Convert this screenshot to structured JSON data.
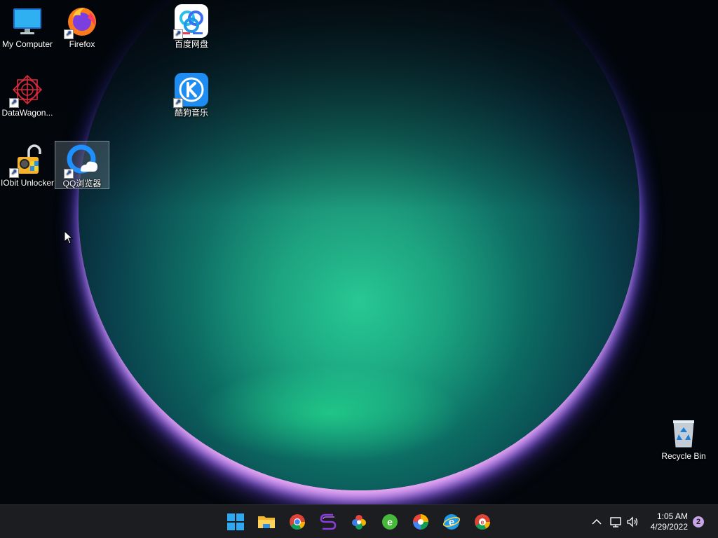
{
  "desktop": {
    "icons": {
      "my_computer": {
        "label": "My Computer",
        "icon": "monitor-icon"
      },
      "firefox": {
        "label": "Firefox",
        "icon": "firefox-icon"
      },
      "baidu": {
        "label": "百度网盘",
        "icon": "baidu-netdisk-icon"
      },
      "datawagon": {
        "label": "DataWagon...",
        "icon": "datawagon-icon"
      },
      "kugou": {
        "label": "酷狗音乐",
        "icon": "kugou-music-icon"
      },
      "iobit": {
        "label": "IObit Unlocker",
        "icon": "iobit-unlocker-icon"
      },
      "qq": {
        "label": "QQ浏览器",
        "icon": "qq-browser-icon"
      },
      "recycle": {
        "label": "Recycle Bin",
        "icon": "recycle-bin-icon"
      }
    }
  },
  "taskbar": {
    "apps": [
      {
        "name": "start-button",
        "icon": "windows-logo-icon"
      },
      {
        "name": "file-explorer",
        "icon": "folder-icon"
      },
      {
        "name": "chrome",
        "icon": "chrome-icon"
      },
      {
        "name": "app-s",
        "icon": "s-logo-icon"
      },
      {
        "name": "app-pinwheel",
        "icon": "pinwheel-icon"
      },
      {
        "name": "app-green-e",
        "icon": "green-e-icon"
      },
      {
        "name": "app-colorful",
        "icon": "colorful-ring-icon"
      },
      {
        "name": "internet-explorer",
        "icon": "ie-icon"
      },
      {
        "name": "chrome-2",
        "icon": "chrome-icon"
      }
    ],
    "tray": {
      "time": "1:05 AM",
      "date": "4/29/2022",
      "notification_count": "2"
    }
  },
  "colors": {
    "taskbar_bg": "#1c1d21",
    "accent_blue": "#1e90ff",
    "badge": "#c9a5e8"
  }
}
